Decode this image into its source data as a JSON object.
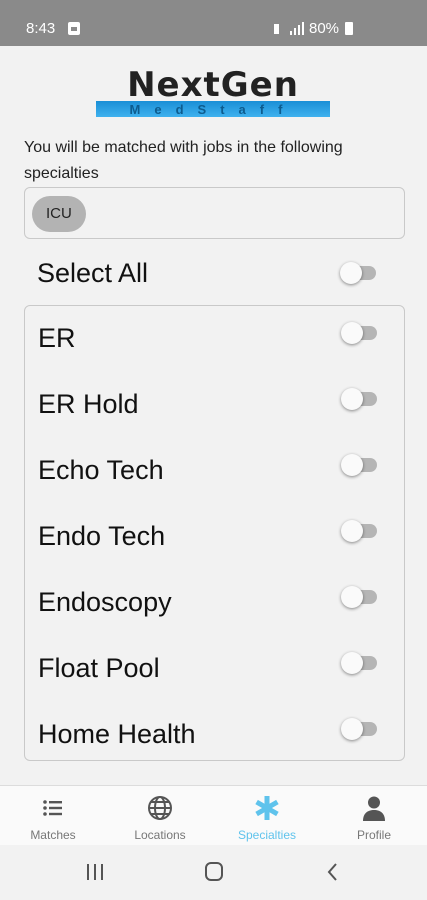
{
  "status_bar": {
    "time": "8:43",
    "battery": "80%"
  },
  "logo": {
    "word": "NextGen",
    "sub": "MedStaff"
  },
  "intro_text": "You will be matched with jobs in the following specialties",
  "selected_chips": [
    "ICU"
  ],
  "select_all": {
    "label": "Select All",
    "on": false
  },
  "specialties": [
    {
      "label": "ER",
      "on": false
    },
    {
      "label": "ER Hold",
      "on": false
    },
    {
      "label": "Echo Tech",
      "on": false
    },
    {
      "label": "Endo Tech",
      "on": false
    },
    {
      "label": "Endoscopy",
      "on": false
    },
    {
      "label": "Float Pool",
      "on": false
    },
    {
      "label": "Home Health",
      "on": false
    }
  ],
  "tabs": [
    {
      "label": "Matches",
      "icon": "list-icon",
      "active": false
    },
    {
      "label": "Locations",
      "icon": "globe-icon",
      "active": false
    },
    {
      "label": "Specialties",
      "icon": "asterisk-icon",
      "active": true
    },
    {
      "label": "Profile",
      "icon": "person-icon",
      "active": false
    }
  ],
  "colors": {
    "accent": "#5fc3ec",
    "status_bar": "#8a8a8a",
    "logo_blue": "#1a8fd6"
  }
}
